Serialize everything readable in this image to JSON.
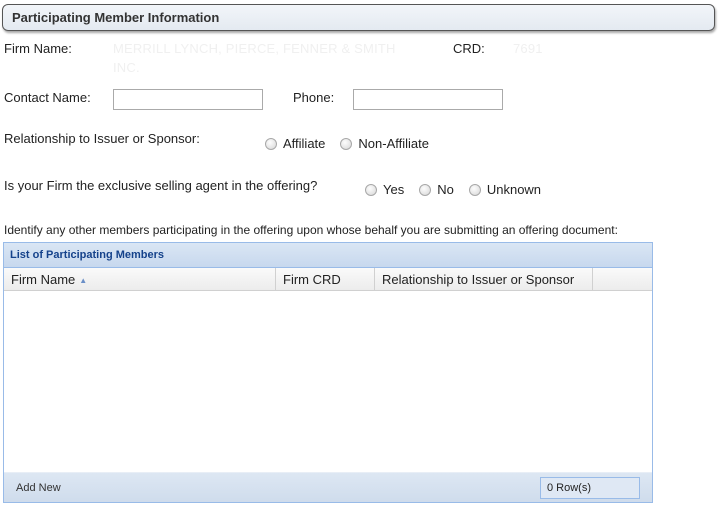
{
  "section": {
    "title": "Participating Member Information"
  },
  "firm": {
    "label": "Firm Name:",
    "value_line1": "MERRILL LYNCH, PIERCE, FENNER & SMITH",
    "value_line2": "INC.",
    "crd_label": "CRD:",
    "crd_value": "7691"
  },
  "contact": {
    "name_label": "Contact Name:",
    "name_value": "",
    "phone_label": "Phone:",
    "phone_value": ""
  },
  "relationship": {
    "label": "Relationship to Issuer or Sponsor:",
    "options": [
      "Affiliate",
      "Non-Affiliate"
    ],
    "selected": null
  },
  "exclusive": {
    "label": "Is your Firm the exclusive selling agent in the offering?",
    "options": [
      "Yes",
      "No",
      "Unknown"
    ],
    "selected": null
  },
  "instructions": "Identify any other members participating in the offering upon whose behalf you are submitting an offering document:",
  "grid": {
    "title": "List of Participating Members",
    "columns": [
      "Firm Name",
      "Firm CRD",
      "Relationship to Issuer or Sponsor"
    ],
    "sort_column": "Firm Name",
    "sort_direction": "ascending",
    "rows": [],
    "add_new_label": "Add New",
    "row_count_label": "0 Row(s)"
  },
  "colors": {
    "grid_border": "#99bbe8",
    "grid_title_text": "#15428b"
  }
}
